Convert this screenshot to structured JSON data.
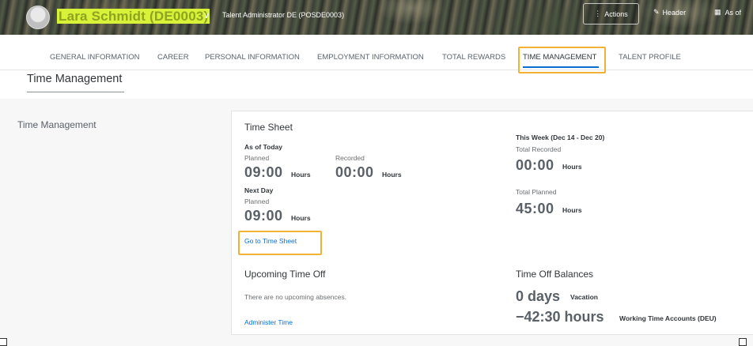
{
  "header": {
    "user_name": "Lara Schmidt (DE0003)",
    "job_title": "Talent Administrator DE (POSDE0003)",
    "actions_label": "Actions",
    "header_label": "Header",
    "as_of_label": "As of"
  },
  "tabs": [
    {
      "label": "GENERAL INFORMATION"
    },
    {
      "label": "CAREER"
    },
    {
      "label": "PERSONAL INFORMATION"
    },
    {
      "label": "EMPLOYMENT INFORMATION"
    },
    {
      "label": "TOTAL REWARDS"
    },
    {
      "label": "TIME MANAGEMENT",
      "active": true
    },
    {
      "label": "TALENT PROFILE"
    }
  ],
  "section": {
    "title": "Time Management",
    "side_label": "Time Management"
  },
  "time_sheet": {
    "heading": "Time Sheet",
    "as_of_today": "As of Today",
    "planned_label": "Planned",
    "planned_value": "09:00",
    "recorded_label": "Recorded",
    "recorded_value": "00:00",
    "hours_unit": "Hours",
    "next_day": "Next Day",
    "next_planned_label": "Planned",
    "next_planned_value": "09:00",
    "link": "Go to Time Sheet"
  },
  "this_week": {
    "heading": "This Week (Dec 14 - Dec 20)",
    "total_recorded_label": "Total Recorded",
    "total_recorded_value": "00:00",
    "total_planned_label": "Total Planned",
    "total_planned_value": "45:00",
    "hours_unit": "Hours"
  },
  "upcoming": {
    "heading": "Upcoming Time Off",
    "empty_text": "There are no upcoming absences.",
    "link": "Administer Time"
  },
  "balances": {
    "heading": "Time Off Balances",
    "vacation_value": "0 days",
    "vacation_label": "Vacation",
    "wta_value": "−42:30 hours",
    "wta_label": "Working Time Accounts (DEU)"
  },
  "colors": {
    "highlight": "#f2b233",
    "link": "#0a6ed1",
    "active_tab_underline": "#0a6ed1"
  }
}
